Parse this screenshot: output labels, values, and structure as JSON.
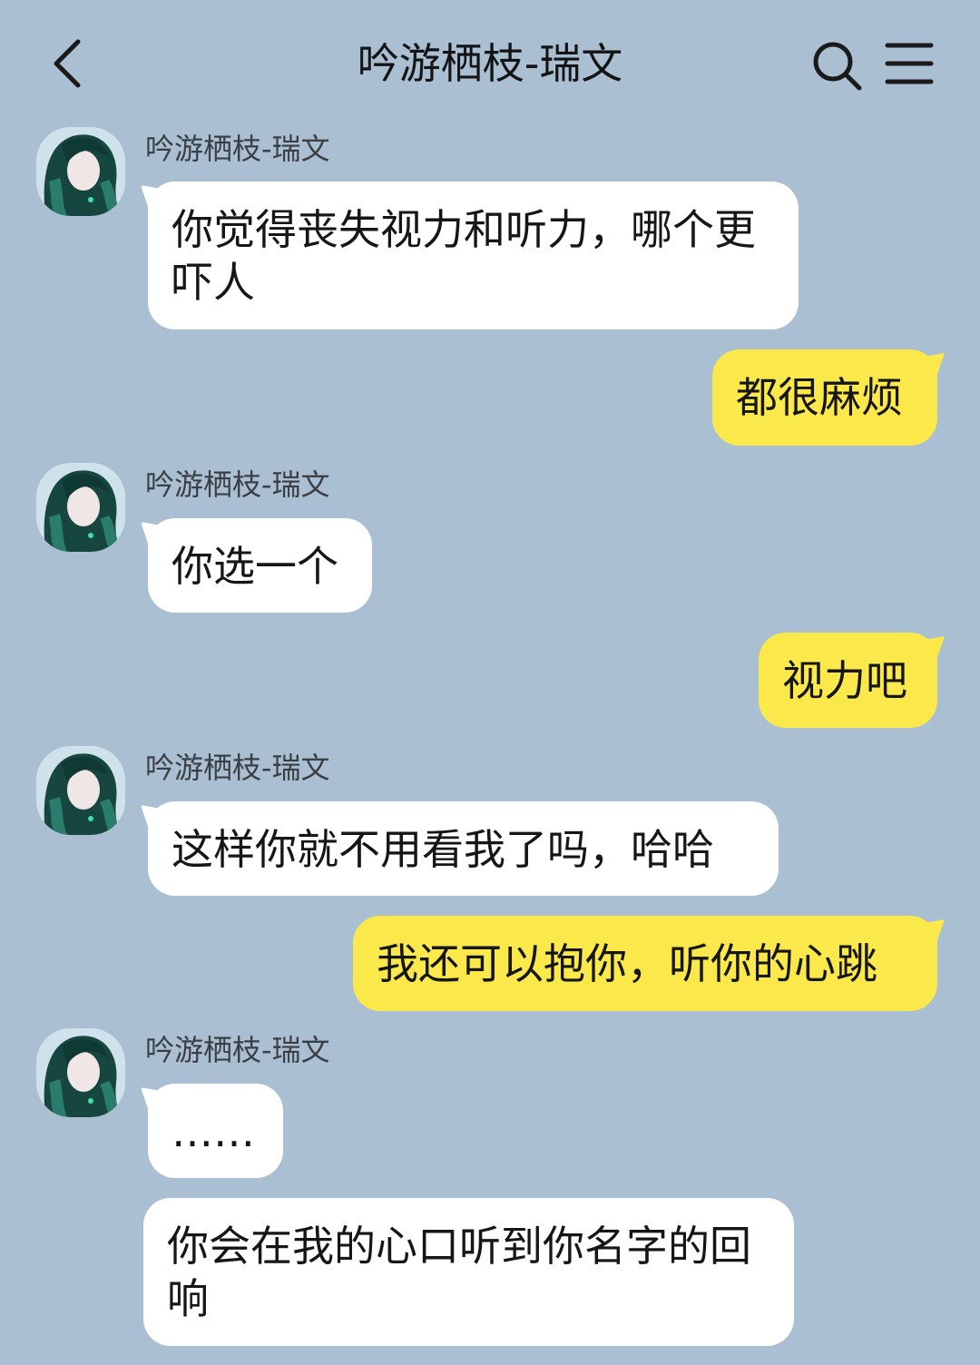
{
  "header": {
    "title": "吟游栖枝-瑞文"
  },
  "icons": {
    "back": "chevron-left-icon",
    "search": "search-icon",
    "menu": "hamburger-menu-icon"
  },
  "colors": {
    "background": "#aabfd2",
    "incoming_bubble": "#ffffff",
    "outgoing_bubble": "#fbe94b"
  },
  "messages": [
    {
      "sender": "吟游栖枝-瑞文",
      "text": "你觉得丧失视力和听力，哪个更吓人"
    },
    {
      "text": "都很麻烦"
    },
    {
      "sender": "吟游栖枝-瑞文",
      "text": "你选一个"
    },
    {
      "text": "视力吧"
    },
    {
      "sender": "吟游栖枝-瑞文",
      "text": "这样你就不用看我了吗，哈哈"
    },
    {
      "text": "我还可以抱你，听你的心跳"
    },
    {
      "sender": "吟游栖枝-瑞文",
      "text": "……"
    },
    {
      "text": "你会在我的心口听到你名字的回响"
    }
  ]
}
